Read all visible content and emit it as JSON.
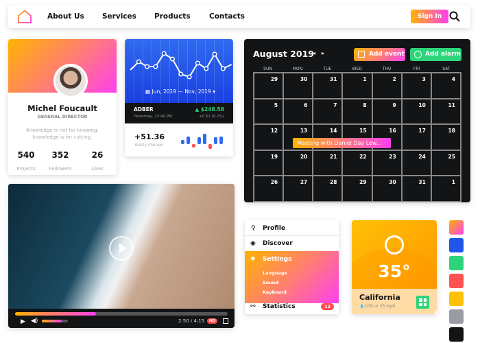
{
  "nav": {
    "links": [
      "About Us",
      "Services",
      "Products",
      "Contacts"
    ],
    "signin": "Sign In",
    "icons": [
      "home-logo",
      "search-icon"
    ]
  },
  "profile": {
    "name": "Michel Foucault",
    "role": "GENERAL DIRECTOR",
    "quote": "Knowledge is not for knowing: knowledge is for cutting.",
    "stats": [
      {
        "value": "540",
        "label": "Projects"
      },
      {
        "value": "352",
        "label": "Followers"
      },
      {
        "value": "26",
        "label": "Likes"
      }
    ]
  },
  "stock": {
    "range": "Jun, 2019 — Nov, 2019",
    "ticker": "ADBER",
    "time": "Yesterday, 12:40 PM",
    "price": "$248.58",
    "change": "+0.51 (0.2%)",
    "yearly": "+51.36",
    "yearly_label": "Yearly change",
    "line": [
      45,
      33,
      40,
      40,
      21,
      29,
      51,
      55,
      35,
      43,
      22,
      43,
      37
    ],
    "bars": [
      6,
      11,
      -5,
      10,
      15,
      -7,
      10,
      11
    ],
    "colors": {
      "up": "#2ecc71",
      "bar": "#2f6bf0",
      "neg": "#ff4d4d"
    }
  },
  "calendar": {
    "title": "August 2019",
    "add_event": "Add event",
    "add_alarm": "Add alarm",
    "days": [
      "SUN",
      "MON",
      "TUE",
      "WED",
      "THU",
      "FRI",
      "SAT"
    ],
    "dates": [
      "29",
      "30",
      "31",
      "1",
      "2",
      "3",
      "4",
      "5",
      "6",
      "7",
      "8",
      "9",
      "10",
      "11",
      "12",
      "13",
      "14",
      "15",
      "16",
      "17",
      "18",
      "19",
      "20",
      "21",
      "22",
      "23",
      "24",
      "25",
      "26",
      "27",
      "28",
      "29",
      "30",
      "31",
      "1"
    ],
    "event": "Meeting with Daniel Day Lew..."
  },
  "video": {
    "time": "2:50 / 4:15",
    "hd": "HD",
    "progress": 0.38,
    "volume": 0.75
  },
  "menu": {
    "items": [
      "Profile",
      "Discover",
      "Settings",
      "Statistics"
    ],
    "sub": [
      "Language",
      "Sound",
      "Keyboard"
    ],
    "badge": "12"
  },
  "weather": {
    "temp": "35°",
    "city": "California",
    "humidity": "10%",
    "wind": "35 mph"
  },
  "swatches": [
    "#ff8a65",
    "#1f55e8",
    "#2ed47a",
    "#ff5252",
    "#ffc107",
    "#9a9ca3",
    "#121416"
  ]
}
